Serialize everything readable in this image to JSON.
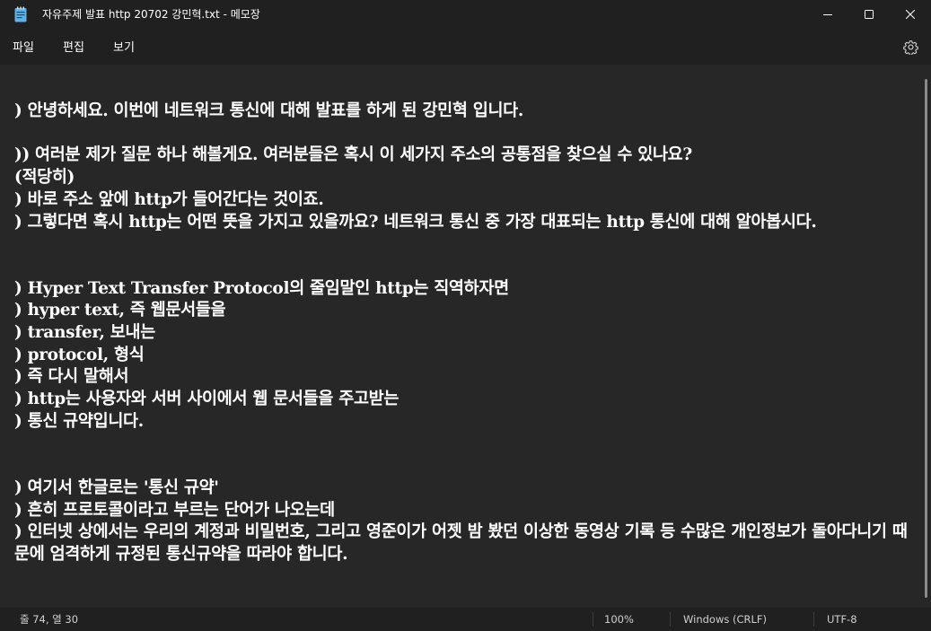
{
  "window": {
    "title": "자유주제 발표 http 20702 강민혁.txt - 메모장",
    "icon": "notepad-icon"
  },
  "menu": {
    "file": "파일",
    "edit": "편집",
    "view": "보기"
  },
  "editor": {
    "content": ") 안녕하세요. 이번에 네트워크 통신에 대해 발표를 하게 된 강민혁 입니다.\n\n)) 여러분 제가 질문 하나 해볼게요. 여러분들은 혹시 이 세가지 주소의 공통점을 찾으실 수 있나요?\n(적당히)\n) 바로 주소 앞에 http가 들어간다는 것이죠.\n) 그렇다면 혹시 http는 어떤 뜻을 가지고 있을까요? 네트워크 통신 중 가장 대표되는 http 통신에 대해 알아봅시다.\n\n\n) Hyper Text Transfer Protocol의 줄임말인 http는 직역하자면\n) hyper text, 즉 웹문서들을\n) transfer, 보내는\n) protocol, 형식\n) 즉 다시 말해서\n) http는 사용자와 서버 사이에서 웹 문서들을 주고받는\n) 통신 규약입니다.\n\n\n) 여기서 한글로는 '통신 규약'\n) 흔히 프로토콜이라고 부르는 단어가 나오는데\n) 인터넷 상에서는 우리의 계정과 비밀번호, 그리고 영준이가 어젯 밤 봤던 이상한 동영상 기록 등 수많은 개인정보가 돌아다니기 때문에 엄격하게 규정된 통신규약을 따라야 합니다."
  },
  "status": {
    "position": "줄 74, 열 30",
    "zoom": "100%",
    "line_ending": "Windows (CRLF)",
    "encoding": "UTF-8"
  },
  "colors": {
    "background": "#272727",
    "chrome": "#202020",
    "text": "#ffffff",
    "status_text": "#d0d0d0"
  }
}
